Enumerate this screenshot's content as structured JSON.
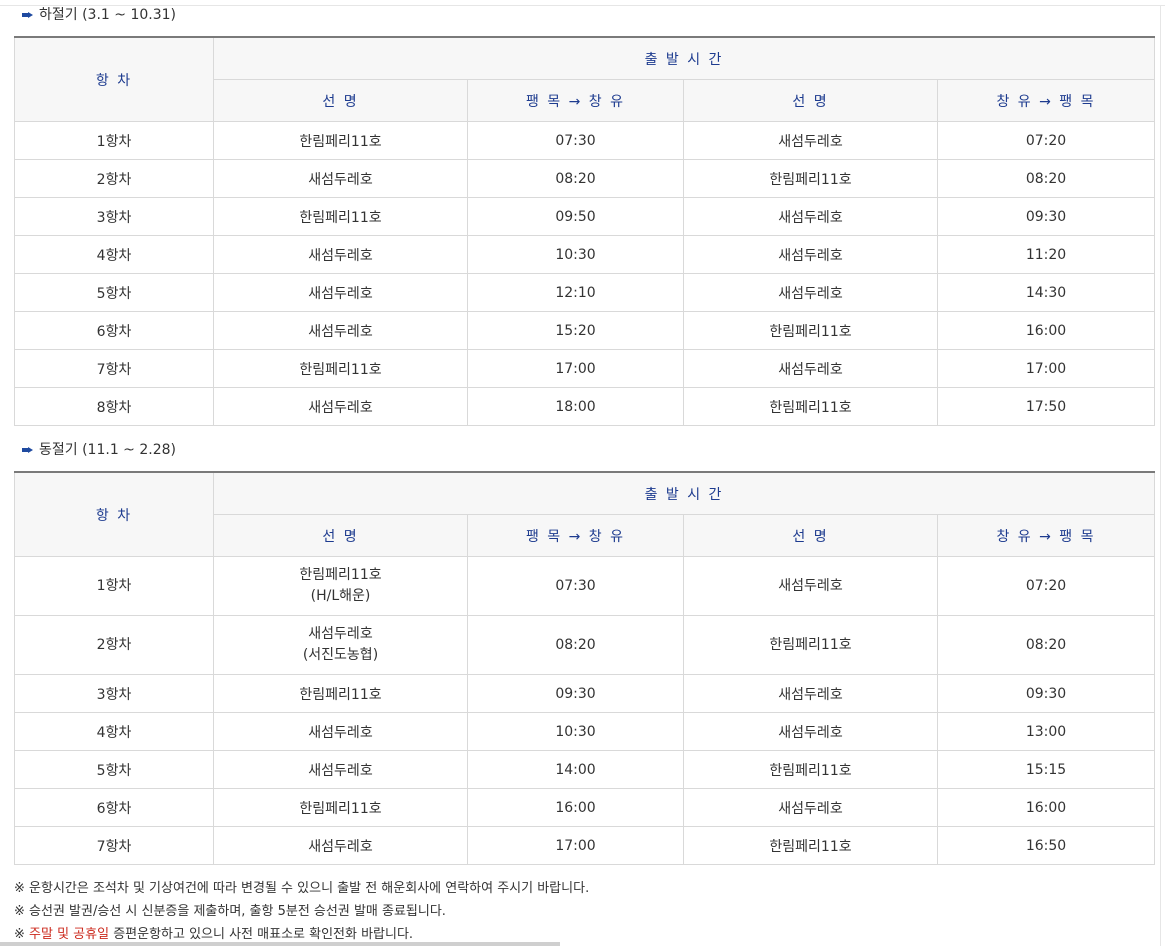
{
  "sections": [
    {
      "title": "하절기 (3.1 ~ 10.31)",
      "headers": {
        "trip": "항 차",
        "departure": "출 발 시 간",
        "ship1": "선 명",
        "route1": "팽 목 → 창 유",
        "ship2": "선 명",
        "route2": "창 유 → 팽 목"
      },
      "rows": [
        {
          "trip": "1항차",
          "ship_a": "한림페리11호",
          "time_a": "07:30",
          "ship_b": "새섬두레호",
          "time_b": "07:20"
        },
        {
          "trip": "2항차",
          "ship_a": "새섬두레호",
          "time_a": "08:20",
          "ship_b": "한림페리11호",
          "time_b": "08:20"
        },
        {
          "trip": "3항차",
          "ship_a": "한림페리11호",
          "time_a": "09:50",
          "ship_b": "새섬두레호",
          "time_b": "09:30"
        },
        {
          "trip": "4항차",
          "ship_a": "새섬두레호",
          "time_a": "10:30",
          "ship_b": "새섬두레호",
          "time_b": "11:20"
        },
        {
          "trip": "5항차",
          "ship_a": "새섬두레호",
          "time_a": "12:10",
          "ship_b": "새섬두레호",
          "time_b": "14:30"
        },
        {
          "trip": "6항차",
          "ship_a": "새섬두레호",
          "time_a": "15:20",
          "ship_b": "한림페리11호",
          "time_b": "16:00"
        },
        {
          "trip": "7항차",
          "ship_a": "한림페리11호",
          "time_a": "17:00",
          "ship_b": "새섬두레호",
          "time_b": "17:00"
        },
        {
          "trip": "8항차",
          "ship_a": "새섬두레호",
          "time_a": "18:00",
          "ship_b": "한림페리11호",
          "time_b": "17:50"
        }
      ]
    },
    {
      "title": "동절기 (11.1 ~ 2.28)",
      "headers": {
        "trip": "항 차",
        "departure": "출 발 시 간",
        "ship1": "선 명",
        "route1": "팽 목 → 창 유",
        "ship2": "선 명",
        "route2": "창 유 → 팽 목"
      },
      "rows": [
        {
          "trip": "1항차",
          "ship_a": "한림페리11호",
          "ship_a_note": "(H/L해운)",
          "time_a": "07:30",
          "ship_b": "새섬두레호",
          "time_b": "07:20"
        },
        {
          "trip": "2항차",
          "ship_a": "새섬두레호",
          "ship_a_note": "(서진도농협)",
          "time_a": "08:20",
          "ship_b": "한림페리11호",
          "time_b": "08:20"
        },
        {
          "trip": "3항차",
          "ship_a": "한림페리11호",
          "time_a": "09:30",
          "ship_b": "새섬두레호",
          "time_b": "09:30"
        },
        {
          "trip": "4항차",
          "ship_a": "새섬두레호",
          "time_a": "10:30",
          "ship_b": "새섬두레호",
          "time_b": "13:00"
        },
        {
          "trip": "5항차",
          "ship_a": "새섬두레호",
          "time_a": "14:00",
          "ship_b": "한림페리11호",
          "time_b": "15:15"
        },
        {
          "trip": "6항차",
          "ship_a": "한림페리11호",
          "time_a": "16:00",
          "ship_b": "새섬두레호",
          "time_b": "16:00"
        },
        {
          "trip": "7항차",
          "ship_a": "새섬두레호",
          "time_a": "17:00",
          "ship_b": "한림페리11호",
          "time_b": "16:50"
        }
      ]
    }
  ],
  "notes": {
    "line1": "※ 운항시간은 조석차 및 기상여건에 따라 변경될 수 있으니 출발 전 해운회사에 연락하여 주시기 바랍니다.",
    "line2": "※ 승선권 발권/승선 시 신분증을 제출하며, 출항 5분전 승선권 발매 종료됩니다.",
    "line3_prefix": "※ ",
    "line3_highlight": "주말 및 공휴일",
    "line3_rest": " 증편운항하고 있으니 사전 매표소로 확인전화 바랍니다."
  },
  "colors": {
    "header_text": "#1d3b8f",
    "header_bg": "#f7f7f7",
    "border": "#d9d9d9",
    "highlight": "#cc2a1e",
    "bullet": "#1f4aa0"
  }
}
